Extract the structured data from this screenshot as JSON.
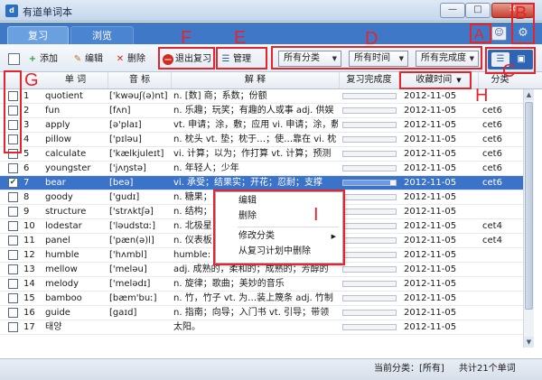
{
  "window": {
    "app_icon": "d",
    "title": "有道单词本",
    "minimize_symbol": "—",
    "maximize_symbol": "□",
    "close_symbol": "✕"
  },
  "tabs": [
    {
      "label": "复习",
      "active": true
    },
    {
      "label": "浏览",
      "active": false
    }
  ],
  "header_icons": {
    "user": "user-icon",
    "settings": "gear-icon"
  },
  "toolbar": {
    "add_label": "添加",
    "edit_label": "编辑",
    "delete_label": "删除",
    "exit_review_label": "退出复习",
    "manage_label": "管理"
  },
  "filters": {
    "category": "所有分类",
    "time": "所有时间",
    "completion": "所有完成度"
  },
  "columns": {
    "word": "单 词",
    "phonetic": "音 标",
    "definition": "解 释",
    "progress": "复习完成度",
    "date": "收藏时间",
    "category": "分类"
  },
  "rows": [
    {
      "num": "1",
      "word": "quotient",
      "phonetic": "['kwəuʃ(ə)nt]",
      "definition": "n. [数] 商；系数；份额",
      "progress": 0,
      "date": "2012-11-05",
      "category": "",
      "checked": false,
      "selected": false
    },
    {
      "num": "2",
      "word": "fun",
      "phonetic": "[fʌn]",
      "definition": "n. 乐趣；玩笑；有趣的人或事 adj. 供娱",
      "progress": 0,
      "date": "2012-11-05",
      "category": "cet6",
      "checked": false,
      "selected": false
    },
    {
      "num": "3",
      "word": "apply",
      "phonetic": "[ə'plaɪ]",
      "definition": "vt. 申请；涂，敷；应用 vi. 申请；涂，敷",
      "progress": 0,
      "date": "2012-11-05",
      "category": "cet6",
      "checked": false,
      "selected": false
    },
    {
      "num": "4",
      "word": "pillow",
      "phonetic": "['pɪləu]",
      "definition": "n. 枕头 vt. 垫；枕于…；使…靠在 vi. 枕",
      "progress": 0,
      "date": "2012-11-05",
      "category": "cet6",
      "checked": false,
      "selected": false
    },
    {
      "num": "5",
      "word": "calculate",
      "phonetic": "['kælkjuleɪt]",
      "definition": "vi. 计算；以为；作打算 vt. 计算；预测",
      "progress": 0,
      "date": "2012-11-05",
      "category": "cet6",
      "checked": false,
      "selected": false
    },
    {
      "num": "6",
      "word": "youngster",
      "phonetic": "['jʌŋstə]",
      "definition": "n. 年轻人；少年",
      "progress": 0,
      "date": "2012-11-05",
      "category": "cet6",
      "checked": false,
      "selected": false
    },
    {
      "num": "7",
      "word": "bear",
      "phonetic": "[beə]",
      "definition": "vi. 承受；结果实；开花；忍耐；支撑",
      "progress": 0.9,
      "date": "2012-11-05",
      "category": "cet6",
      "checked": true,
      "selected": true
    },
    {
      "num": "8",
      "word": "goody",
      "phonetic": "['gudɪ]",
      "definition": "n. 糖果；",
      "progress": 0,
      "date": "2012-11-05",
      "category": "",
      "checked": false,
      "selected": false
    },
    {
      "num": "9",
      "word": "structure",
      "phonetic": "['strʌktʃə]",
      "definition": "n. 结构；",
      "progress": 0,
      "date": "2012-11-05",
      "category": "",
      "checked": false,
      "selected": false
    },
    {
      "num": "10",
      "word": "lodestar",
      "phonetic": "['ləudstɑː]",
      "definition": "n. 北极星",
      "progress": 0,
      "date": "2012-11-05",
      "category": "cet4",
      "checked": false,
      "selected": false
    },
    {
      "num": "11",
      "word": "panel",
      "phonetic": "['pæn(ə)l]",
      "definition": "n. 仪表板",
      "progress": 0,
      "date": "2012-11-05",
      "category": "cet4",
      "checked": false,
      "selected": false
    },
    {
      "num": "12",
      "word": "humble",
      "phonetic": "['hʌmbl]",
      "definition": "humble: 恭顺的 | 谦逊的 | 谦虚的",
      "progress": 0,
      "date": "2012-11-05",
      "category": "",
      "checked": false,
      "selected": false
    },
    {
      "num": "13",
      "word": "mellow",
      "phonetic": "['meləu]",
      "definition": "adj. 成熟的，柔和的；成熟的；芳醇的",
      "progress": 0,
      "date": "2012-11-05",
      "category": "",
      "checked": false,
      "selected": false
    },
    {
      "num": "14",
      "word": "melody",
      "phonetic": "['melədɪ]",
      "definition": "n. 旋律；歌曲；美妙的音乐",
      "progress": 0,
      "date": "2012-11-05",
      "category": "",
      "checked": false,
      "selected": false
    },
    {
      "num": "15",
      "word": "bamboo",
      "phonetic": "[bæm'buː]",
      "definition": "n. 竹，竹子 vt. 为…装上篾条 adj. 竹制",
      "progress": 0,
      "date": "2012-11-05",
      "category": "",
      "checked": false,
      "selected": false
    },
    {
      "num": "16",
      "word": "guide",
      "phonetic": "[gaɪd]",
      "definition": "n. 指南；向导；入门书 vt. 引导；带领",
      "progress": 0,
      "date": "2012-11-05",
      "category": "",
      "checked": false,
      "selected": false
    },
    {
      "num": "17",
      "word": "태양",
      "phonetic": "",
      "definition": "太阳。",
      "progress": 0,
      "date": "2012-11-05",
      "category": "",
      "checked": false,
      "selected": false
    }
  ],
  "context_menu": {
    "items": [
      "编辑",
      "删除",
      "修改分类",
      "从复习计划中删除"
    ],
    "submenu_arrow": "▶"
  },
  "status": {
    "current_category": "当前分类：[所有]",
    "total": "共计21个单词"
  },
  "callouts": [
    "A",
    "B",
    "C",
    "D",
    "E",
    "F",
    "G",
    "H",
    "I"
  ],
  "colors": {
    "accent": "#3f78c7",
    "selection": "#3b73c9",
    "callout": "#e5242b"
  }
}
